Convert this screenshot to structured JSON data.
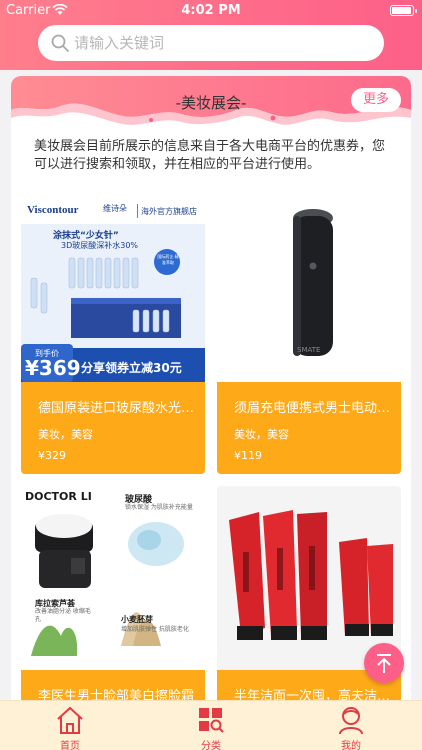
{
  "status_bar": {
    "carrier": "Carrier",
    "time": "4:02 PM"
  },
  "search": {
    "placeholder": "请输入关键词"
  },
  "section": {
    "title": "-美妆展会-",
    "more_label": "更多",
    "description": "美妆展会目前所展示的信息来自于各大电商平台的优惠券，您可以进行搜索和领取，并在相应的平台进行使用。"
  },
  "products": [
    {
      "name": "德国原装进口玻尿酸水光精华液",
      "tags": "美妆，美容",
      "price": "¥329",
      "image": {
        "brand": "Viscontour",
        "brand_cn": "维诗朵",
        "store": "海外官方旗舰店",
        "slogan": "涂抹式“少女针”",
        "subslogan": "3D玻尿酸深补水30%",
        "badge": "国际药企 精准萃取",
        "price_label": "到手价",
        "price_value": "¥369",
        "coupon": "分享领券立减30元"
      }
    },
    {
      "name": "须眉充电便携式男士电动剃须刀",
      "tags": "美妆，美容",
      "price": "¥119",
      "image": {
        "logo": "SMATE"
      }
    },
    {
      "name": "李医生男士脸部美白擦脸霜",
      "tags": "",
      "price": "",
      "image": {
        "brand": "DOCTOR LI",
        "ingredient_1": "玻尿酸",
        "ingredient_1_desc": "锁水保湿 为肌肤补充能量",
        "ingredient_2": "库拉索芦荟",
        "ingredient_2_desc": "改善油脂分泌 收缩毛孔",
        "ingredient_3": "小麦胚芽",
        "ingredient_3_desc": "增加肌肤弹性 抗肌肤老化"
      }
    },
    {
      "name": "半年洁面一次囤，高夫洁面乳",
      "tags": "",
      "price": "",
      "image": {}
    }
  ],
  "tabbar": {
    "home": "首页",
    "category": "分类",
    "mine": "我的"
  },
  "colors": {
    "accent": "#fd5f88",
    "card_orange": "#fea918",
    "tab_active": "#e23b43"
  }
}
